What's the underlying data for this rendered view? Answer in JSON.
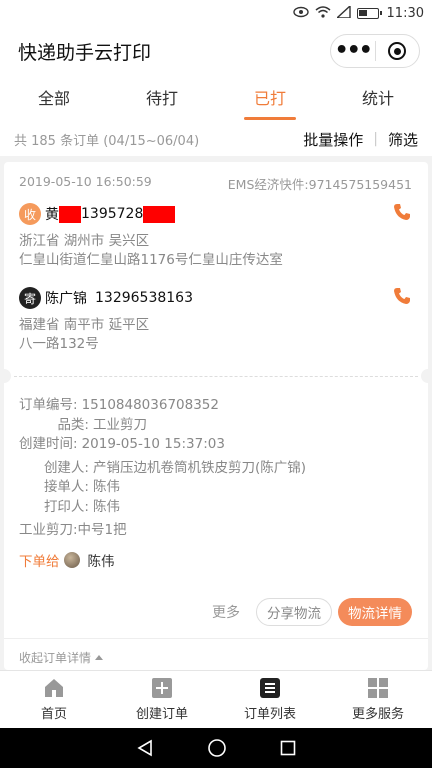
{
  "status_bar": {
    "time": "11:30"
  },
  "header": {
    "title": "快递助手云打印"
  },
  "tabs": [
    {
      "label": "全部"
    },
    {
      "label": "待打"
    },
    {
      "label": "已打"
    },
    {
      "label": "统计"
    }
  ],
  "summary": {
    "count_text": "共 185 条订单 (04/15~06/04)",
    "batch_label": "批量操作",
    "filter_label": "筛选"
  },
  "order": {
    "time": "2019-05-10 16:50:59",
    "express": "EMS经济快件:9714575159451",
    "receiver": {
      "badge": "收",
      "name_prefix": "黄",
      "phone_visible": "1395728",
      "line1": "浙江省 湖州市 吴兴区",
      "line2": "仁皇山街道仁皇山路1176号仁皇山庄传达室"
    },
    "sender": {
      "badge": "寄",
      "name": "陈广锦",
      "phone": "13296538163",
      "line1": "福建省 南平市 延平区",
      "line2": "八一路132号"
    },
    "details": [
      {
        "label": "订单编号:",
        "value": "1510848036708352"
      },
      {
        "label": "品类:",
        "value": "工业剪刀"
      },
      {
        "label": "创建时间:",
        "value": "2019-05-10 15:37:03"
      },
      {
        "label": "创建人:",
        "value": "产销压边机卷筒机铁皮剪刀(陈广锦)"
      },
      {
        "label": "接单人:",
        "value": "陈伟"
      },
      {
        "label": "打印人:",
        "value": "陈伟"
      }
    ],
    "goods_note": "工业剪刀:中号1把",
    "assign_label": "下单给",
    "assign_name": "陈伟",
    "more_label": "更多",
    "share_label": "分享物流",
    "logistics_label": "物流详情",
    "collapse_label": "收起订单详情"
  },
  "bottom_nav": [
    {
      "label": "首页",
      "icon": "home-icon"
    },
    {
      "label": "创建订单",
      "icon": "plus-icon"
    },
    {
      "label": "订单列表",
      "icon": "list-icon"
    },
    {
      "label": "更多服务",
      "icon": "grid-icon"
    }
  ],
  "colors": {
    "accent": "#f07c3a",
    "button_fill": "#f48b5a",
    "redaction": "#ff0000"
  }
}
